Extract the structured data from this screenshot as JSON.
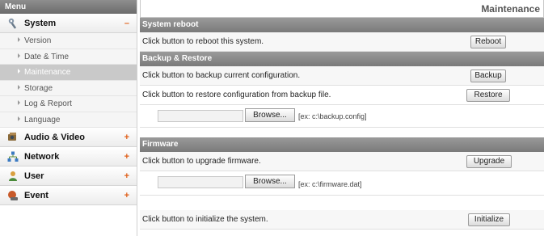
{
  "sidebar": {
    "header": "Menu",
    "items": [
      {
        "label": "System",
        "sign": "–",
        "icon": "wrench-icon"
      },
      {
        "label": "Audio & Video",
        "sign": "+",
        "icon": "camera-icon"
      },
      {
        "label": "Network",
        "sign": "+",
        "icon": "network-icon"
      },
      {
        "label": "User",
        "sign": "+",
        "icon": "user-icon"
      },
      {
        "label": "Event",
        "sign": "+",
        "icon": "event-icon"
      }
    ],
    "subitems": [
      {
        "label": "Version"
      },
      {
        "label": "Date & Time"
      },
      {
        "label": "Maintenance"
      },
      {
        "label": "Storage"
      },
      {
        "label": "Log & Report"
      },
      {
        "label": "Language"
      }
    ]
  },
  "page": {
    "title": "Maintenance"
  },
  "reboot": {
    "header": "System reboot",
    "text": "Click button to reboot this system.",
    "button": "Reboot"
  },
  "backup": {
    "header": "Backup & Restore",
    "backup_text": "Click button to backup current configuration.",
    "backup_button": "Backup",
    "restore_text": "Click button to restore configuration from backup file.",
    "restore_button": "Restore",
    "browse_button": "Browse...",
    "hint": "[ex: c:\\backup.config]"
  },
  "firmware": {
    "header": "Firmware",
    "text": "Click button to upgrade firmware.",
    "button": "Upgrade",
    "browse_button": "Browse...",
    "hint": "[ex: c:\\firmware.dat]"
  },
  "initialize": {
    "text": "Click button to initialize the system.",
    "button": "Initialize"
  }
}
